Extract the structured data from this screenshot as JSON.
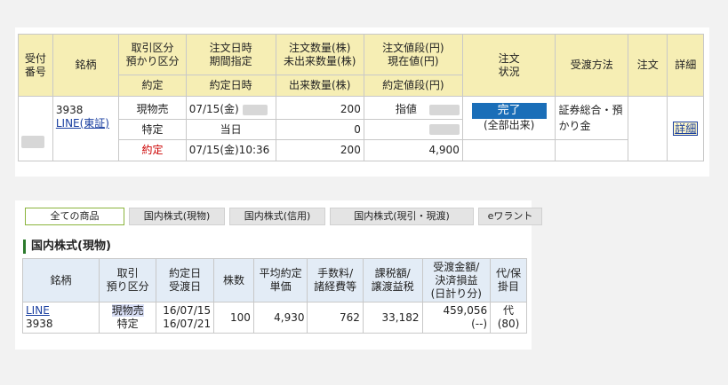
{
  "order": {
    "headers": {
      "c1": [
        "受付",
        "番号"
      ],
      "c2": "銘柄",
      "c3": [
        "取引区分",
        "預かり区分"
      ],
      "c3b": "約定",
      "c4": [
        "注文日時",
        "期間指定"
      ],
      "c4b": "約定日時",
      "c5": [
        "注文数量(株)",
        "未出来数量(株)"
      ],
      "c5b": "出来数量(株)",
      "c6": [
        "注文値段(円)",
        "現在値(円)"
      ],
      "c6b": "約定値段(円)",
      "c7": [
        "注文",
        "状況"
      ],
      "c8": "受渡方法",
      "c9": "注文",
      "c10": "詳細"
    },
    "row": {
      "code": "3938",
      "name": "LINE(東証)",
      "trade_type": "現物売",
      "account_type": "特定",
      "contract_label": "約定",
      "order_date": "07/15(金)",
      "period": "当日",
      "contract_datetime": "07/15(金)10:36",
      "order_qty": "200",
      "unfilled_qty": "0",
      "filled_qty": "200",
      "price_type": "指値",
      "contract_price": "4,900",
      "status_button": "完了",
      "status_sub": "(全部出来)",
      "delivery": "証券総合・預かり金",
      "detail": "詳細"
    }
  },
  "positions": {
    "tabs": [
      "全ての商品",
      "国内株式(現物)",
      "国内株式(信用)",
      "国内株式(現引・現渡)",
      "eワラント"
    ],
    "section_title": "国内株式(現物)",
    "headers": {
      "h1": "銘柄",
      "h2": [
        "取引",
        "預り区分"
      ],
      "h3": [
        "約定日",
        "受渡日"
      ],
      "h4": "株数",
      "h5": [
        "平均約定",
        "単価"
      ],
      "h6": [
        "手数料/",
        "諸経費等"
      ],
      "h7": [
        "課税額/",
        "譲渡益税"
      ],
      "h8": [
        "受渡金額/",
        "決済損益",
        "(日計り分)"
      ],
      "h9": [
        "代/保",
        "掛目"
      ]
    },
    "row": {
      "name": "LINE",
      "code": "3938",
      "trade": "現物売",
      "account": "特定",
      "contract_date": "16/07/15",
      "delivery_date": "16/07/21",
      "qty": "100",
      "avg_price": "4,930",
      "fee": "762",
      "tax": "33,182",
      "amount": "459,056",
      "pl": "(--)",
      "dai": "代",
      "kake": "(80)"
    }
  }
}
